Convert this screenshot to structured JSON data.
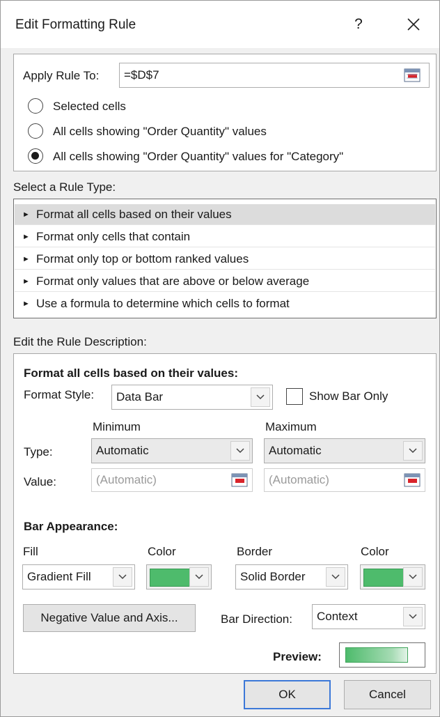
{
  "dialog": {
    "title": "Edit Formatting Rule",
    "help_glyph": "?"
  },
  "apply": {
    "label_prefix": "Apply Rule To:",
    "value": "=$D$7",
    "options": [
      {
        "label": "Selected cells",
        "checked": false
      },
      {
        "label": "All cells showing \"Order Quantity\" values",
        "checked": false
      },
      {
        "label": "All cells showing \"Order Quantity\" values for \"Category\"",
        "checked": true
      }
    ]
  },
  "rule_type": {
    "heading": "Select a Rule Type:",
    "items": [
      "Format all cells based on their values",
      "Format only cells that contain",
      "Format only top or bottom ranked values",
      "Format only values that are above or below average",
      "Use a formula to determine which cells to format"
    ],
    "selected_index": 0
  },
  "description": {
    "heading": "Edit the Rule Description:",
    "subheading": "Format all cells based on their values:",
    "format_style_label": "Format Style:",
    "format_style_value": "Data Bar",
    "show_bar_only_label": "Show Bar Only",
    "show_bar_only_checked": false,
    "minimum_label": "Minimum",
    "maximum_label": "Maximum",
    "type_label": "Type:",
    "value_label": "Value:",
    "min_type": "Automatic",
    "max_type": "Automatic",
    "min_value": "(Automatic)",
    "max_value": "(Automatic)"
  },
  "bar_appearance": {
    "heading": "Bar Appearance:",
    "fill_label": "Fill",
    "fill_value": "Gradient Fill",
    "color_label": "Color",
    "border_label": "Border",
    "border_value": "Solid Border",
    "border_color_label": "Color",
    "fill_color": "#4EBB6C",
    "border_color": "#4EBB6C",
    "negative_button": "Negative Value and Axis...",
    "bar_direction_label": "Bar Direction:",
    "bar_direction_value": "Context",
    "preview_label": "Preview:"
  },
  "footer": {
    "ok_label": "OK",
    "cancel_label": "Cancel"
  }
}
